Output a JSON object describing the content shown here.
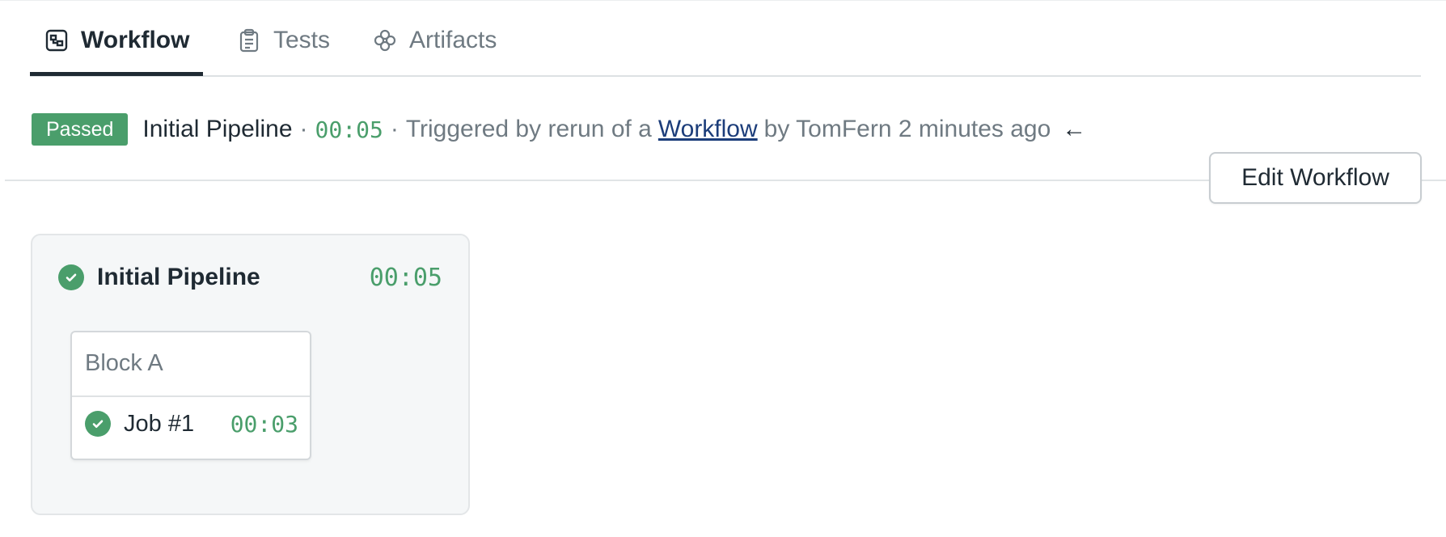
{
  "tabs": [
    {
      "label": "Workflow",
      "icon": "workflow-icon",
      "active": true
    },
    {
      "label": "Tests",
      "icon": "clipboard-icon",
      "active": false
    },
    {
      "label": "Artifacts",
      "icon": "artifacts-icon",
      "active": false
    }
  ],
  "status": {
    "badge": "Passed",
    "pipeline_name": "Initial Pipeline",
    "separator": "·",
    "duration": "00:05",
    "trigger_text": "Triggered by rerun of a",
    "trigger_link": "Workflow",
    "by_text": "by TomFern 2 minutes ago",
    "arrow": "←"
  },
  "edit_button": "Edit Workflow",
  "pipeline": {
    "title": "Initial Pipeline",
    "duration": "00:05",
    "blocks": [
      {
        "title": "Block A",
        "jobs": [
          {
            "label": "Job #1",
            "duration": "00:03"
          }
        ]
      }
    ]
  },
  "colors": {
    "passed": "#4a9e6b",
    "link": "#1c3d7a",
    "text": "#1f2a33",
    "muted": "#6f7a82"
  }
}
